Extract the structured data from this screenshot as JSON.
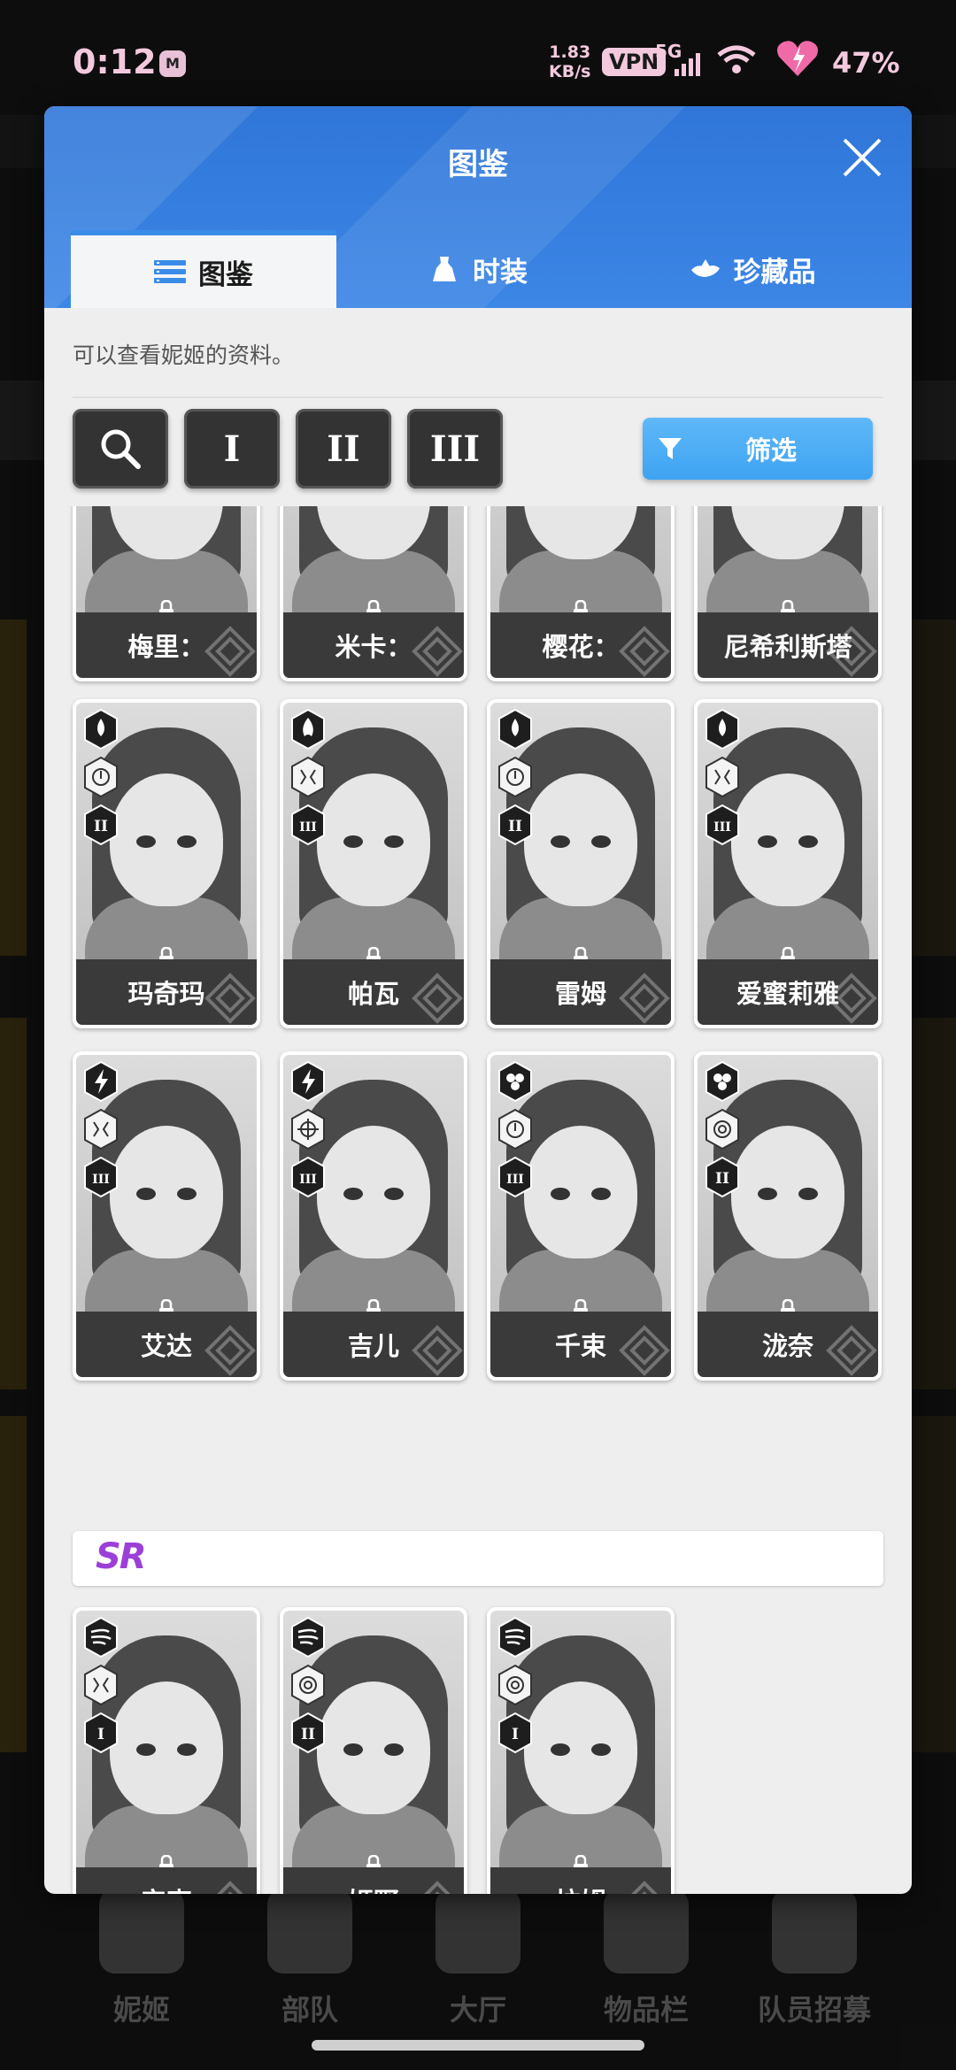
{
  "status_bar": {
    "time": "0:12",
    "app_icon": "M",
    "net_speed_value": "1.83",
    "net_speed_unit": "KB/s",
    "vpn": "VPN",
    "network": "5G",
    "battery": "47%"
  },
  "modal": {
    "title": "图鉴",
    "tabs": [
      {
        "label": "图鉴",
        "icon": "list-icon",
        "active": true
      },
      {
        "label": "时装",
        "icon": "dress-icon",
        "active": false
      },
      {
        "label": "珍藏品",
        "icon": "treasure-icon",
        "active": false
      }
    ],
    "description": "可以查看妮姬的资料。",
    "toolbar": {
      "search_icon": "search-icon",
      "tier_buttons": [
        "I",
        "II",
        "III"
      ],
      "filter_label": "筛选"
    },
    "partial_row": [
      "梅里：",
      "米卡：",
      "樱花：",
      "尼希利斯塔"
    ],
    "ssr_rows": [
      [
        {
          "name": "玛奇玛",
          "element": "water",
          "weapon": "rifle",
          "burst": "II"
        },
        {
          "name": "帕瓦",
          "element": "fire",
          "weapon": "shotgun",
          "burst": "III"
        },
        {
          "name": "雷姆",
          "element": "water",
          "weapon": "rifle",
          "burst": "II"
        },
        {
          "name": "爱蜜莉雅",
          "element": "water",
          "weapon": "shotgun",
          "burst": "III"
        }
      ],
      [
        {
          "name": "艾达",
          "element": "electric",
          "weapon": "shotgun",
          "burst": "III"
        },
        {
          "name": "吉儿",
          "element": "electric",
          "weapon": "sniper",
          "burst": "III"
        },
        {
          "name": "千束",
          "element": "iron",
          "weapon": "rifle",
          "burst": "III"
        },
        {
          "name": "泷奈",
          "element": "iron",
          "weapon": "smg",
          "burst": "II"
        }
      ]
    ],
    "sr_label": "SR",
    "sr_row": [
      {
        "name": "安克",
        "element": "wind",
        "weapon": "shotgun",
        "burst": "I"
      },
      {
        "name": "姬野",
        "element": "wind",
        "weapon": "smg",
        "burst": "II"
      },
      {
        "name": "拉姆",
        "element": "wind",
        "weapon": "smg",
        "burst": "I"
      }
    ]
  },
  "bottom_nav": [
    "妮姬",
    "部队",
    "大厅",
    "物品栏",
    "队员招募"
  ],
  "colors": {
    "header_blue": "#3a82e2",
    "filter_blue": "#45a8f4",
    "sr_purple": "#9b3fd9",
    "status_pink": "#f3c9de"
  }
}
